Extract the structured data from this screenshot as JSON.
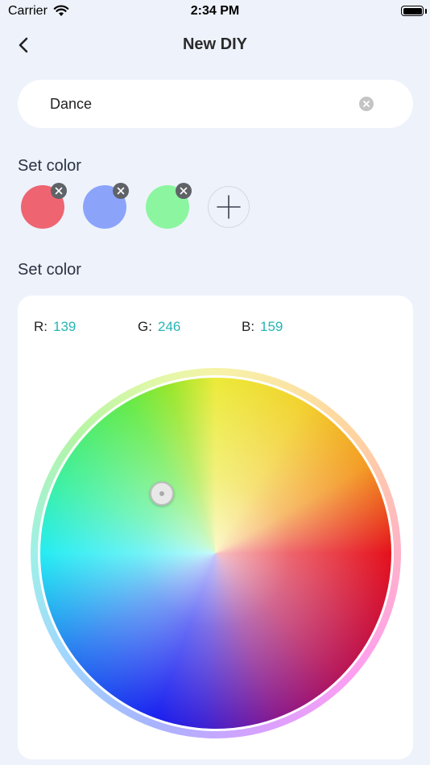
{
  "status_bar": {
    "carrier": "Carrier",
    "time": "2:34 PM"
  },
  "nav": {
    "title": "New DIY"
  },
  "name_field": {
    "value": "Dance"
  },
  "sections": {
    "preset_colors_title": "Set color",
    "picker_title": "Set color"
  },
  "swatches": [
    {
      "color": "#ee6471"
    },
    {
      "color": "#8ba4fa"
    },
    {
      "color": "#8bf69f"
    }
  ],
  "picker": {
    "r_label": "R:",
    "r_value": "139",
    "g_label": "G:",
    "g_value": "246",
    "b_label": "B:",
    "b_value": "159",
    "accent_color": "#26b5b3"
  }
}
